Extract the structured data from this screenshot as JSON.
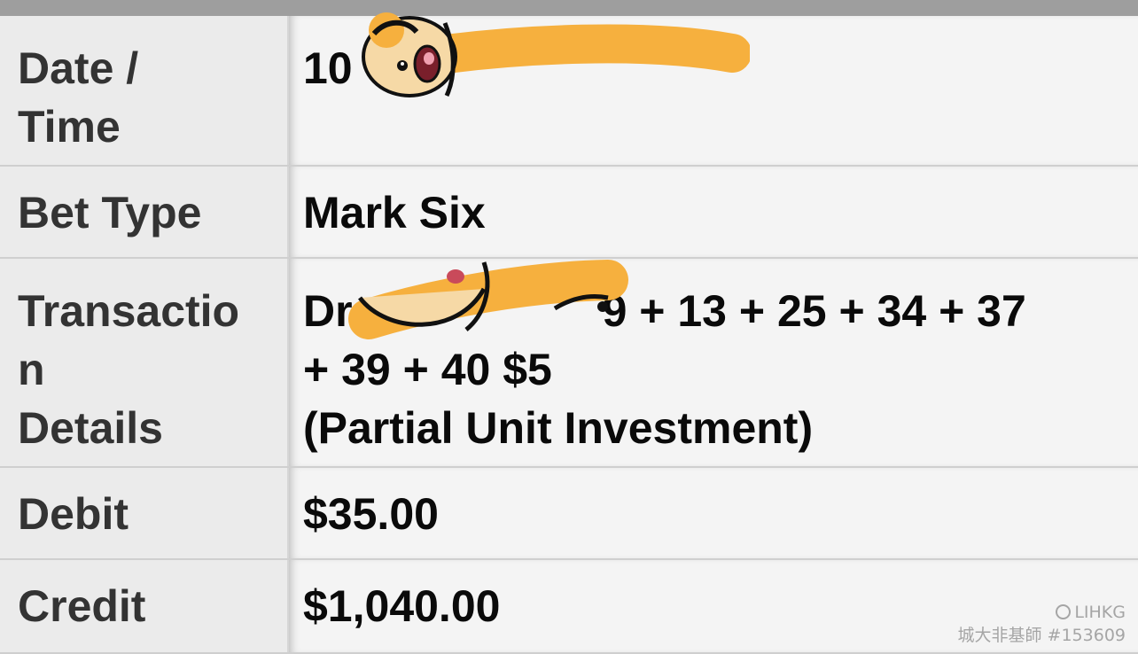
{
  "rows": {
    "datetime": {
      "label_lines": [
        "Date /",
        "Time"
      ],
      "value": "10"
    },
    "bet_type": {
      "label": "Bet Type",
      "value": "Mark Six"
    },
    "details": {
      "label_lines": [
        "Transactio",
        "n",
        "Details"
      ],
      "value_prefix": "Dr",
      "value_rest": "9 + 13 + 25 + 34 + 37",
      "value_line2": "+ 39 + 40 $5",
      "value_line3": "(Partial Unit Investment)"
    },
    "debit": {
      "label": "Debit",
      "value": "$35.00"
    },
    "credit": {
      "label": "Credit",
      "value": "$1,040.00"
    }
  },
  "watermark": {
    "brand": "LIHKG",
    "user": "城大非基師 #153609"
  },
  "colors": {
    "sticker_orange": "#f6b03e",
    "topbar": "#9e9e9e"
  }
}
